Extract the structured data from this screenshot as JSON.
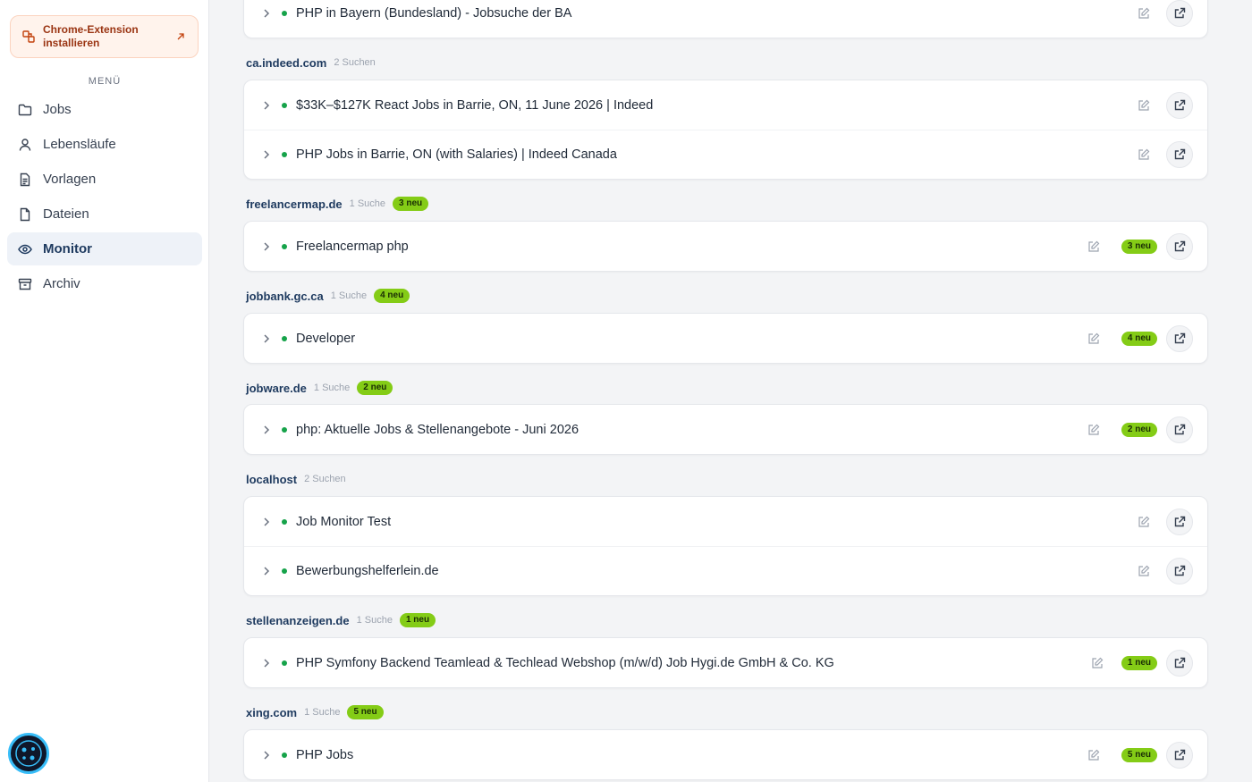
{
  "sidebar": {
    "extension_label": "Chrome-Extension installieren",
    "menu_heading": "MENÜ",
    "items": [
      {
        "label": "Jobs"
      },
      {
        "label": "Lebensläufe"
      },
      {
        "label": "Vorlagen"
      },
      {
        "label": "Dateien"
      },
      {
        "label": "Monitor"
      },
      {
        "label": "Archiv"
      }
    ]
  },
  "groups": [
    {
      "rows": [
        "PHP in Bayern (Bundesland) - Jobsuche der BA"
      ]
    },
    {
      "domain": "ca.indeed.com",
      "count": "2 Suchen",
      "rows": [
        "$33K–$127K React Jobs in Barrie, ON, 11 June 2026 | Indeed",
        "PHP Jobs in Barrie, ON (with Salaries) | Indeed Canada"
      ]
    },
    {
      "domain": "freelancermap.de",
      "count": "1 Suche",
      "badge": "3 neu",
      "rows": [
        "Freelancermap php"
      ],
      "row_badge": "3 neu"
    },
    {
      "domain": "jobbank.gc.ca",
      "count": "1 Suche",
      "badge": "4 neu",
      "rows": [
        "Developer"
      ],
      "row_badge": "4 neu"
    },
    {
      "domain": "jobware.de",
      "count": "1 Suche",
      "badge": "2 neu",
      "rows": [
        "php: Aktuelle Jobs & Stellenangebote - Juni 2026"
      ],
      "row_badge": "2 neu"
    },
    {
      "domain": "localhost",
      "count": "2 Suchen",
      "rows": [
        "Job Monitor Test",
        "Bewerbungshelferlein.de"
      ]
    },
    {
      "domain": "stellenanzeigen.de",
      "count": "1 Suche",
      "badge": "1 neu",
      "rows": [
        "PHP Symfony Backend Teamlead & Techlead Webshop (m/w/d) Job Hygi.de GmbH & Co. KG"
      ],
      "row_badge": "1 neu"
    },
    {
      "domain": "xing.com",
      "count": "1 Suche",
      "badge": "5 neu",
      "rows": [
        "PHP Jobs"
      ],
      "row_badge": "5 neu"
    }
  ],
  "icons": {
    "extension": "puzzle-icon",
    "nav": [
      "folder-icon",
      "user-icon",
      "document-icon",
      "file-icon",
      "eye-icon",
      "archive-icon"
    ],
    "row_expand": "chevron-right-icon",
    "row_edit": "edit-icon",
    "row_open": "external-link-icon"
  },
  "colors": {
    "accent": "#1e3a5f",
    "new_badge": "#84cc16",
    "status_dot": "#16a34a",
    "extension_bg": "#fff3ec"
  }
}
